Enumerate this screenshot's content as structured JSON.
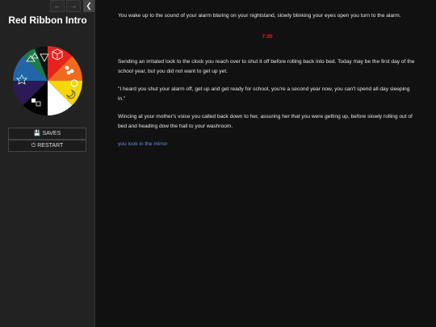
{
  "sidebar": {
    "title": "Red Ribbon Intro",
    "nav_back_icon": "arrow-left-icon",
    "nav_forward_icon": "arrow-right-icon",
    "collapse_icon": "chevron-left-icon",
    "saves_label": "SAVES",
    "restart_label": "RESTART",
    "wheel_colors": {
      "red": "#e8231e",
      "orange": "#f06a1d",
      "yellow": "#f5d800",
      "white": "#ffffff",
      "black": "#000000",
      "purple": "#2b1a55",
      "blue": "#2266a8",
      "green": "#1d7a4a"
    }
  },
  "passage": {
    "p1": "You wake up to the sound of your alarm blaring on your nightstand, slowly blinking your eyes open you turn to the alarm.",
    "alarm_time": "7:30",
    "p2": "Sending an irritated look to the clock you reach over to shut it off before rolling back into bed. Today may be the first day of the school year, but you did not want to get up yet.",
    "p3": "\"I heard you shut your alarm off, get up and get ready for school, you're a second year now, you can't spend all day sleeping in.\"",
    "p4": "Wincing at your mother's voice you called back down to her, assuring her that you were getting up, before slowly rolling out of bed and heading dow the hall to your washroom.",
    "choice": "you look in the mirror"
  }
}
